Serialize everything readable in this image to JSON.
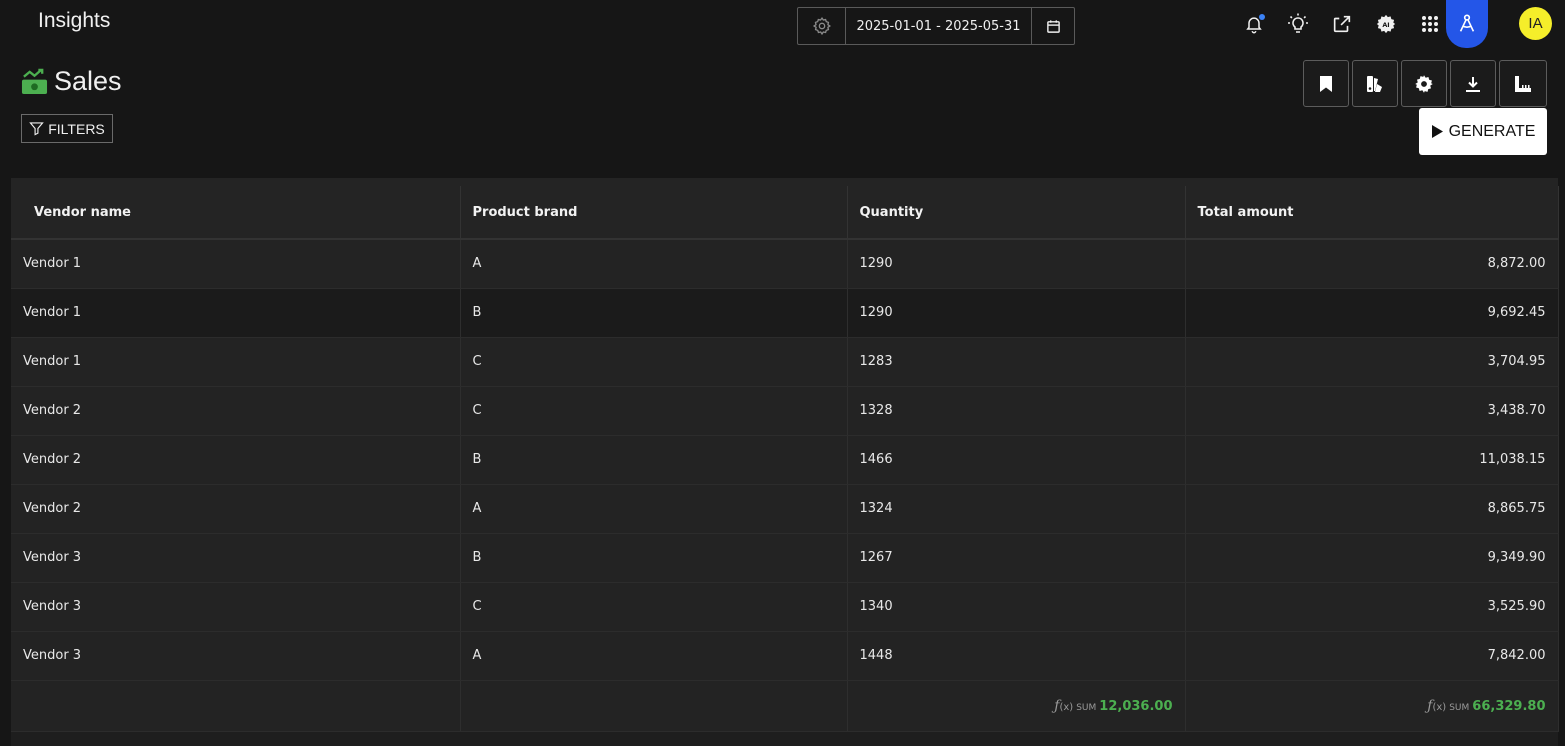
{
  "app": {
    "title": "Insights"
  },
  "date_range": {
    "value": "2025-01-01 - 2025-05-31"
  },
  "user": {
    "initials": "IA"
  },
  "page": {
    "title": "Sales"
  },
  "filters_button": {
    "label": "FILTERS"
  },
  "generate_button": {
    "label": "GENERATE"
  },
  "colors": {
    "accent_blue": "#2456e8",
    "avatar_yellow": "#f5ee2a",
    "sum_green": "#4caf50",
    "page_icon_green": "#4caf50"
  },
  "table": {
    "columns": [
      "Vendor name",
      "Product brand",
      "Quantity",
      "Total amount"
    ],
    "rows": [
      {
        "vendor": "Vendor 1",
        "brand": "A",
        "quantity": "1290",
        "total": "8,872.00"
      },
      {
        "vendor": "Vendor 1",
        "brand": "B",
        "quantity": "1290",
        "total": "9,692.45"
      },
      {
        "vendor": "Vendor 1",
        "brand": "C",
        "quantity": "1283",
        "total": "3,704.95"
      },
      {
        "vendor": "Vendor 2",
        "brand": "C",
        "quantity": "1328",
        "total": "3,438.70"
      },
      {
        "vendor": "Vendor 2",
        "brand": "B",
        "quantity": "1466",
        "total": "11,038.15"
      },
      {
        "vendor": "Vendor 2",
        "brand": "A",
        "quantity": "1324",
        "total": "8,865.75"
      },
      {
        "vendor": "Vendor 3",
        "brand": "B",
        "quantity": "1267",
        "total": "9,349.90"
      },
      {
        "vendor": "Vendor 3",
        "brand": "C",
        "quantity": "1340",
        "total": "3,525.90"
      },
      {
        "vendor": "Vendor 3",
        "brand": "A",
        "quantity": "1448",
        "total": "7,842.00"
      }
    ],
    "footer": {
      "fx_symbol": "ƒ",
      "fx_args": "(x)",
      "sum_label": "SUM",
      "quantity_sum": "12,036.00",
      "total_sum": "66,329.80"
    }
  }
}
